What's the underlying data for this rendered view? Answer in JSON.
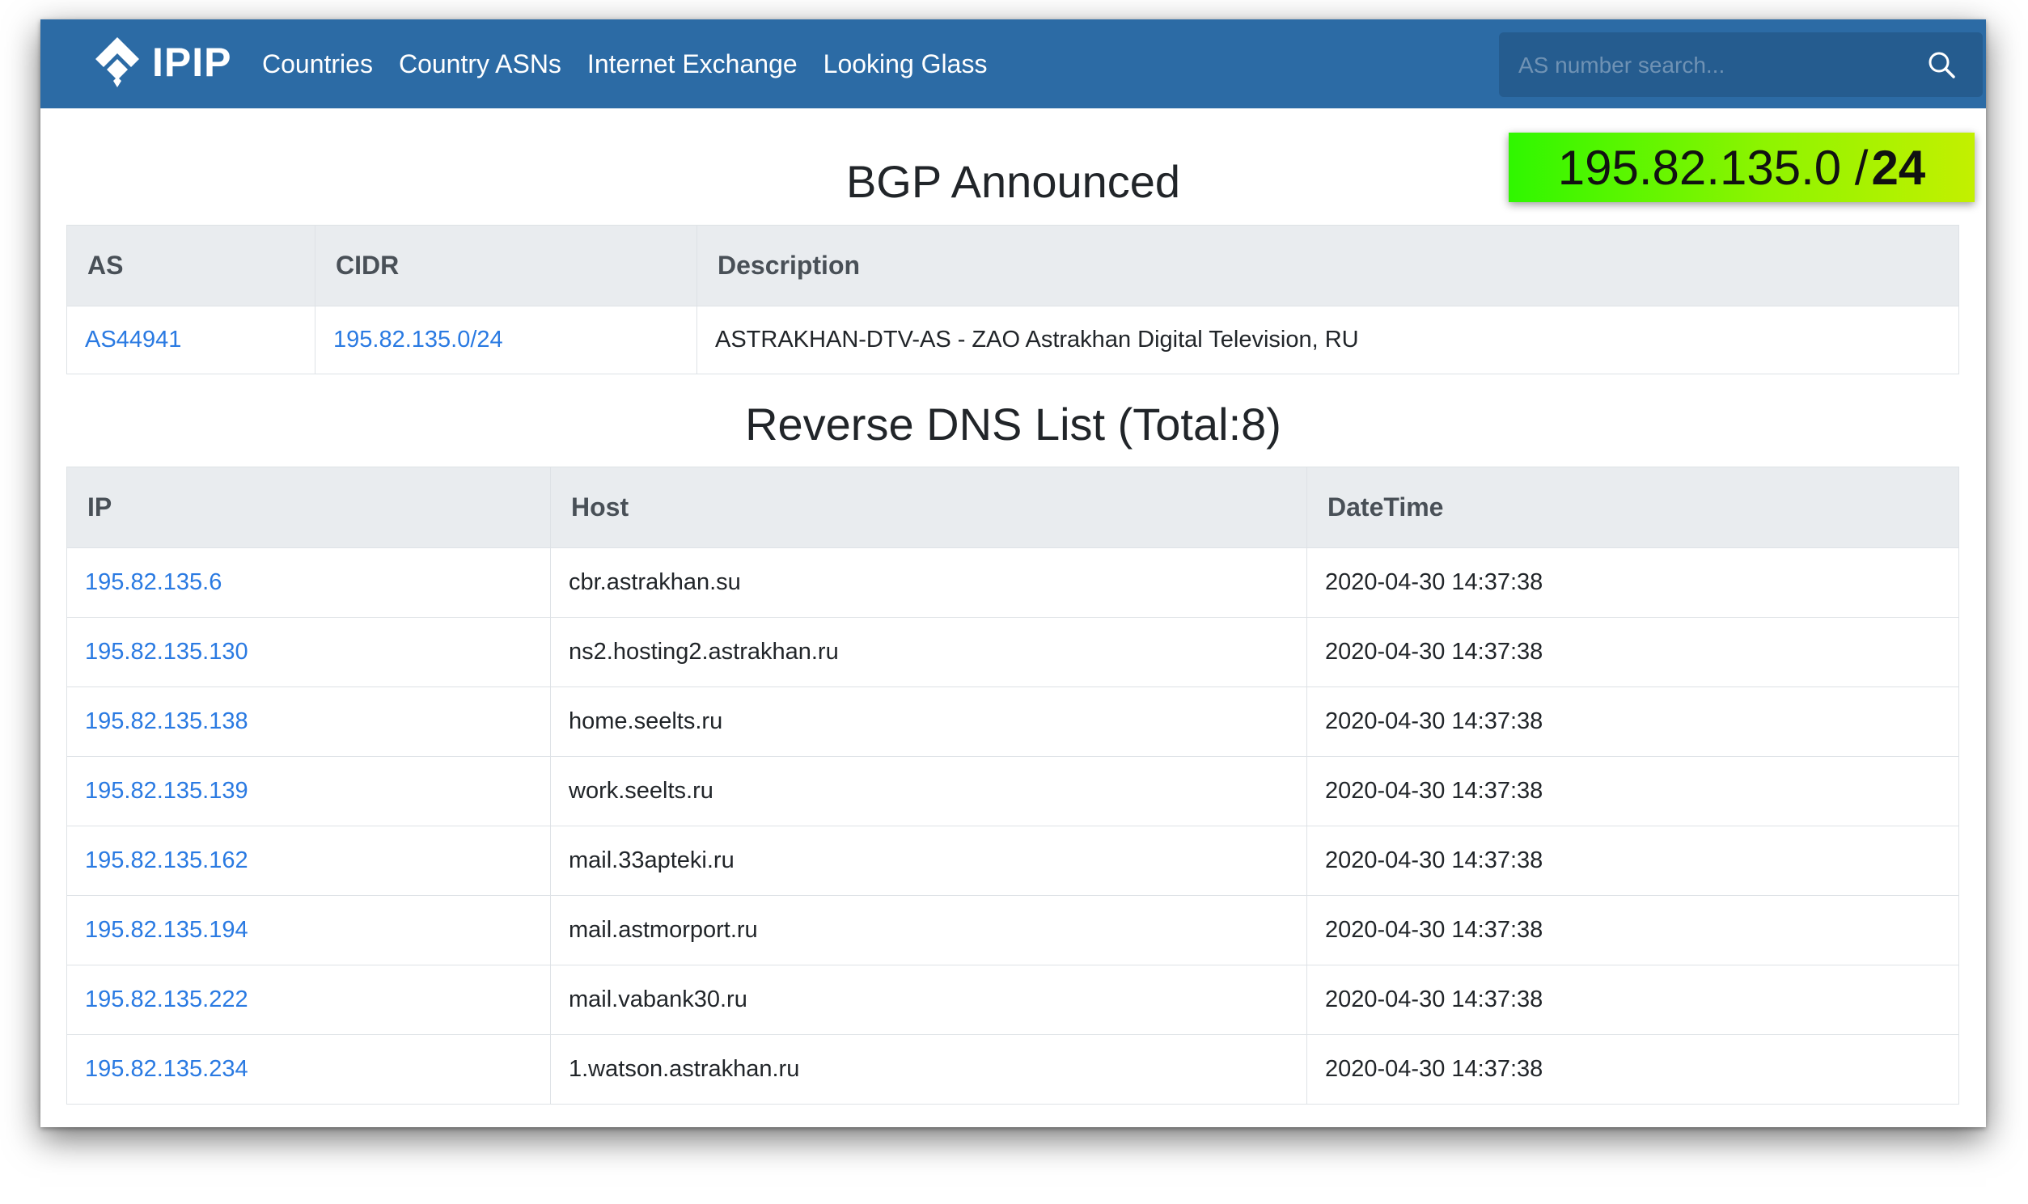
{
  "brand": {
    "name": "IPIP"
  },
  "nav": {
    "items": [
      "Countries",
      "Country ASNs",
      "Internet Exchange",
      "Looking Glass"
    ]
  },
  "search": {
    "placeholder": "AS number search..."
  },
  "cidr_badge": {
    "network": "195.82.135.0 / ",
    "mask": "24",
    "colors": [
      "#2ff700",
      "#c3f000"
    ]
  },
  "bgp": {
    "title": "BGP Announced",
    "headers": [
      "AS",
      "CIDR",
      "Description"
    ],
    "rows": [
      {
        "as": "AS44941",
        "cidr": "195.82.135.0/24",
        "description": "ASTRAKHAN-DTV-AS - ZAO Astrakhan Digital Television, RU"
      }
    ]
  },
  "rdns": {
    "title": "Reverse DNS List (Total:8)",
    "headers": [
      "IP",
      "Host",
      "DateTime"
    ],
    "rows": [
      {
        "ip": "195.82.135.6",
        "host": "cbr.astrakhan.su",
        "datetime": "2020-04-30 14:37:38"
      },
      {
        "ip": "195.82.135.130",
        "host": "ns2.hosting2.astrakhan.ru",
        "datetime": "2020-04-30 14:37:38"
      },
      {
        "ip": "195.82.135.138",
        "host": "home.seelts.ru",
        "datetime": "2020-04-30 14:37:38"
      },
      {
        "ip": "195.82.135.139",
        "host": "work.seelts.ru",
        "datetime": "2020-04-30 14:37:38"
      },
      {
        "ip": "195.82.135.162",
        "host": "mail.33apteki.ru",
        "datetime": "2020-04-30 14:37:38"
      },
      {
        "ip": "195.82.135.194",
        "host": "mail.astmorport.ru",
        "datetime": "2020-04-30 14:37:38"
      },
      {
        "ip": "195.82.135.222",
        "host": "mail.vabank30.ru",
        "datetime": "2020-04-30 14:37:38"
      },
      {
        "ip": "195.82.135.234",
        "host": "1.watson.astrakhan.ru",
        "datetime": "2020-04-30 14:37:38"
      }
    ]
  },
  "colors": {
    "navbar": "#2c6ba5",
    "link": "#2a7ae2",
    "header_bg": "#e9ecef"
  },
  "icons": {
    "logo": "ipip-logo-icon",
    "search": "search-icon"
  }
}
